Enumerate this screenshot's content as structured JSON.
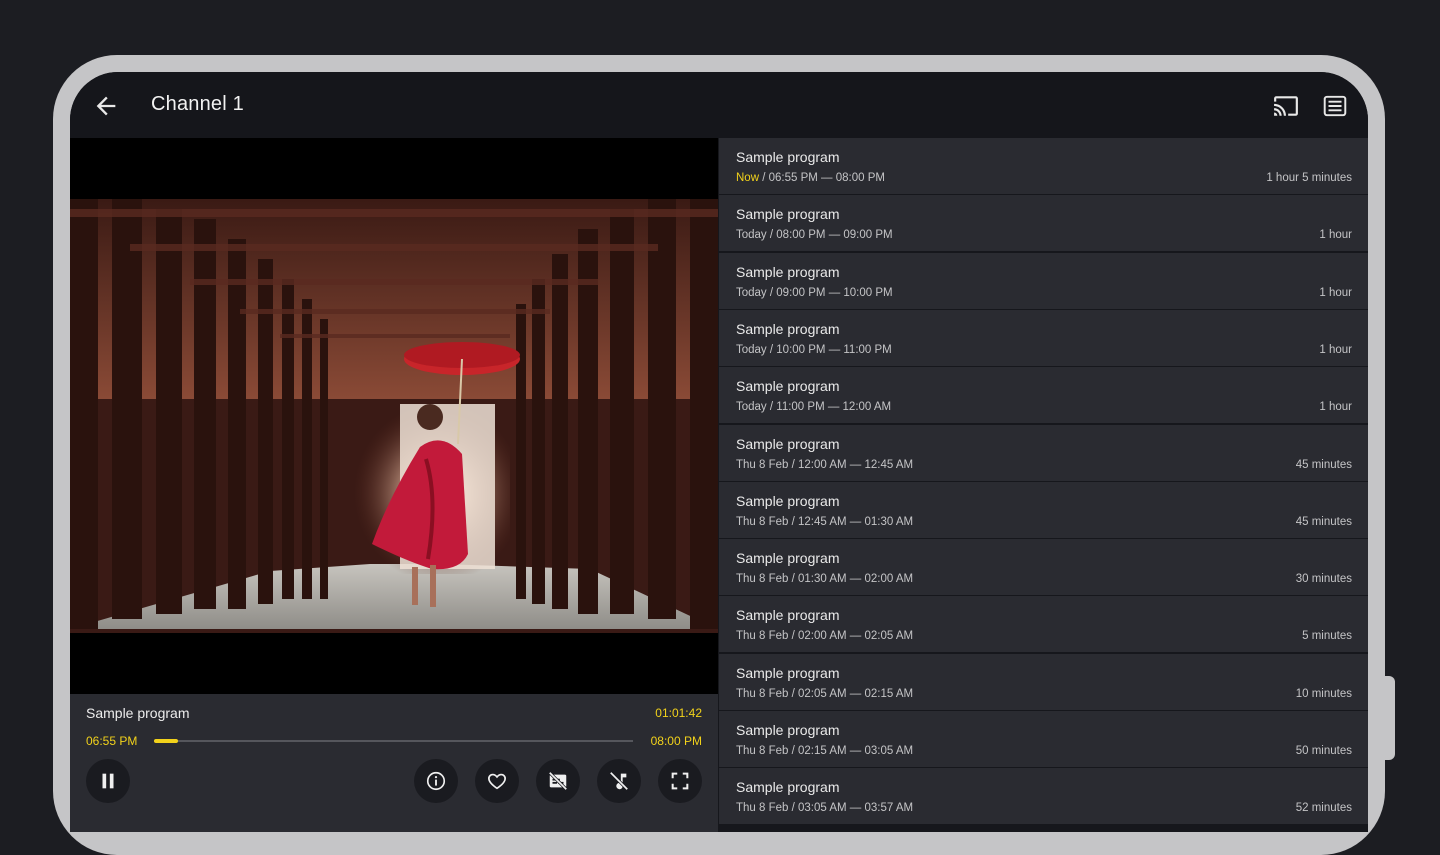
{
  "header": {
    "title": "Channel 1"
  },
  "icons": {
    "back": "arrow-left-icon",
    "cast": "cast-icon",
    "guide": "list-icon"
  },
  "colors": {
    "accent": "#f2d21b",
    "row": "#2a2b31",
    "background": "#15161b"
  },
  "player": {
    "program_title": "Sample program",
    "elapsed": "01:01:42",
    "start_time": "06:55 PM",
    "end_time": "08:00 PM",
    "progress_fraction": 0.05,
    "buttons": [
      "pause",
      "info",
      "favorite",
      "subtitles-off",
      "audio-off",
      "fullscreen"
    ]
  },
  "epg": [
    {
      "title": "Sample program",
      "day": "Now",
      "sep": " / ",
      "range": "06:55 PM — 08:00 PM",
      "duration": "1 hour 5 minutes",
      "current": true
    },
    {
      "title": "Sample program",
      "day": "Today",
      "sep": " / ",
      "range": "08:00 PM — 09:00 PM",
      "duration": "1 hour"
    },
    {
      "title": "Sample program",
      "day": "Today",
      "sep": " / ",
      "range": "09:00 PM — 10:00 PM",
      "duration": "1 hour"
    },
    {
      "title": "Sample program",
      "day": "Today",
      "sep": " / ",
      "range": "10:00 PM — 11:00 PM",
      "duration": "1 hour"
    },
    {
      "title": "Sample program",
      "day": "Today",
      "sep": " / ",
      "range": "11:00 PM — 12:00 AM",
      "duration": "1 hour"
    },
    {
      "title": "Sample program",
      "day": "Thu 8 Feb",
      "sep": " / ",
      "range": "12:00 AM — 12:45 AM",
      "duration": "45 minutes"
    },
    {
      "title": "Sample program",
      "day": "Thu 8 Feb",
      "sep": " / ",
      "range": "12:45 AM — 01:30 AM",
      "duration": "45 minutes"
    },
    {
      "title": "Sample program",
      "day": "Thu 8 Feb",
      "sep": " / ",
      "range": "01:30 AM — 02:00 AM",
      "duration": "30 minutes"
    },
    {
      "title": "Sample program",
      "day": "Thu 8 Feb",
      "sep": " / ",
      "range": "02:00 AM — 02:05 AM",
      "duration": "5 minutes"
    },
    {
      "title": "Sample program",
      "day": "Thu 8 Feb",
      "sep": " / ",
      "range": "02:05 AM — 02:15 AM",
      "duration": "10 minutes"
    },
    {
      "title": "Sample program",
      "day": "Thu 8 Feb",
      "sep": " / ",
      "range": "02:15 AM — 03:05 AM",
      "duration": "50 minutes"
    },
    {
      "title": "Sample program",
      "day": "Thu 8 Feb",
      "sep": " / ",
      "range": "03:05 AM — 03:57 AM",
      "duration": "52 minutes"
    }
  ]
}
